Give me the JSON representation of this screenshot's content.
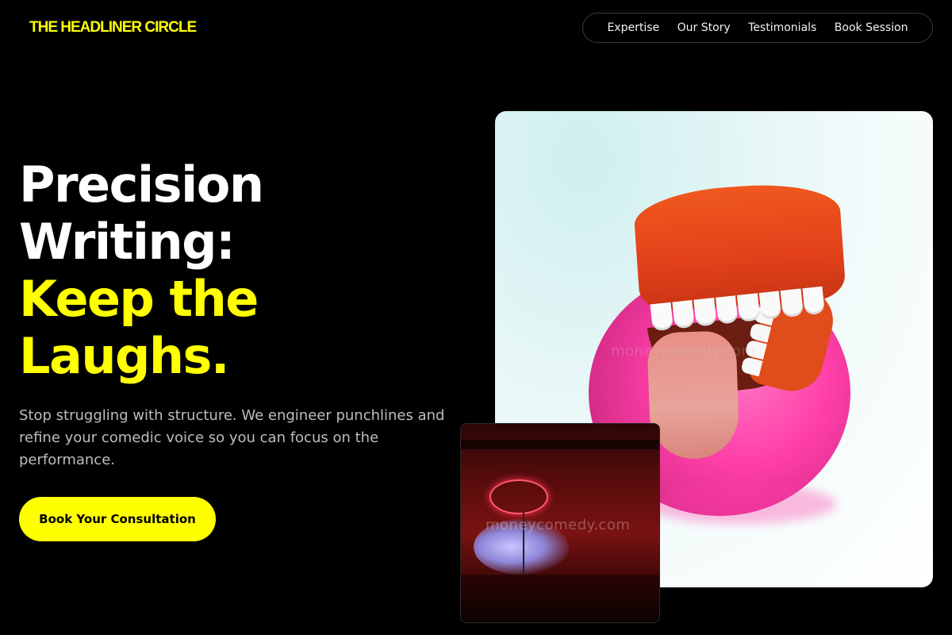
{
  "brand": {
    "logo_text": "THE HEADLINER CIRCLE",
    "accent": "#ffff00"
  },
  "nav": {
    "items": [
      "Expertise",
      "Our Story",
      "Testimonials",
      "Book Session"
    ]
  },
  "hero": {
    "headline_white_1": "Precision",
    "headline_white_2": "Writing:",
    "headline_yellow_1": "Keep the",
    "headline_yellow_2": "Laughs.",
    "subtext": "Stop struggling with structure. We engineer punchlines and refine your comedic voice so you can focus on the performance.",
    "cta_label": "Book Your Consultation"
  },
  "images": {
    "main_alt": "Wind-up chattering teeth toy with tongue out on a pink sponge",
    "small_alt": "Red-lit comedy club stage with neon sign"
  },
  "watermark": {
    "text": "moneycomedy.com"
  },
  "colors": {
    "background": "#000000",
    "accent": "#ffff00",
    "subtext": "#bdbdbd"
  }
}
